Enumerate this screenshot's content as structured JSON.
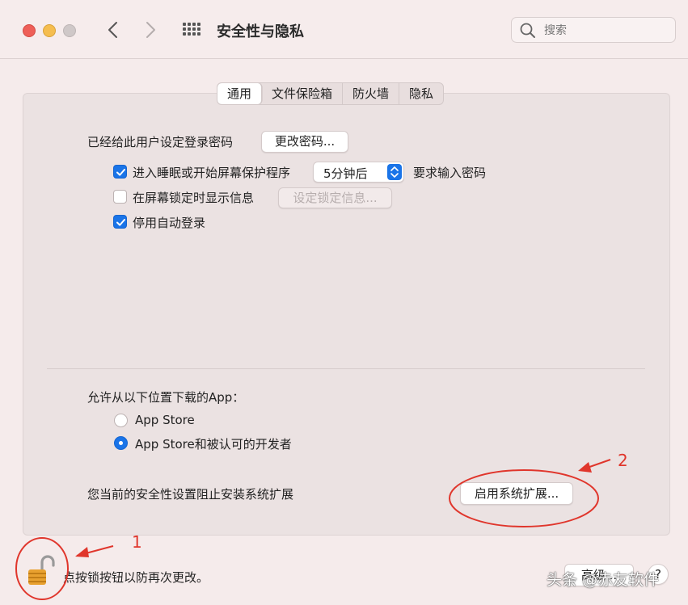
{
  "window": {
    "title": "安全性与隐私",
    "search_placeholder": "搜索"
  },
  "tabs": [
    {
      "label": "通用",
      "active": true
    },
    {
      "label": "文件保险箱",
      "active": false
    },
    {
      "label": "防火墙",
      "active": false
    },
    {
      "label": "隐私",
      "active": false
    }
  ],
  "general": {
    "password_set_label": "已经给此用户设定登录密码",
    "change_password_button": "更改密码...",
    "require_password": {
      "label": "进入睡眠或开始屏幕保护程序",
      "checked": true,
      "delay_value": "5分钟后",
      "suffix": "要求输入密码"
    },
    "show_message": {
      "label": "在屏幕锁定时显示信息",
      "checked": false,
      "button": "设定锁定信息..."
    },
    "disable_auto_login": {
      "label": "停用自动登录",
      "checked": true
    }
  },
  "downloads": {
    "heading": "允许从以下位置下载的App：",
    "options": [
      {
        "label": "App Store",
        "selected": false
      },
      {
        "label": "App Store和被认可的开发者",
        "selected": true
      }
    ]
  },
  "extensions": {
    "message": "您当前的安全性设置阻止安装系统扩展",
    "enable_button": "启用系统扩展..."
  },
  "footer": {
    "lock_text": "点按锁按钮以防再次更改。",
    "advanced_button": "高级...",
    "help_button": "?"
  },
  "annotations": {
    "marker_1": "1",
    "marker_2": "2",
    "color": "#e0362c"
  },
  "watermark": "头条 @赤友软件",
  "colors": {
    "accent": "#1a74e8",
    "red": "#ee5f58",
    "yellow": "#f5bd4f",
    "gray": "#cfc8c8"
  }
}
